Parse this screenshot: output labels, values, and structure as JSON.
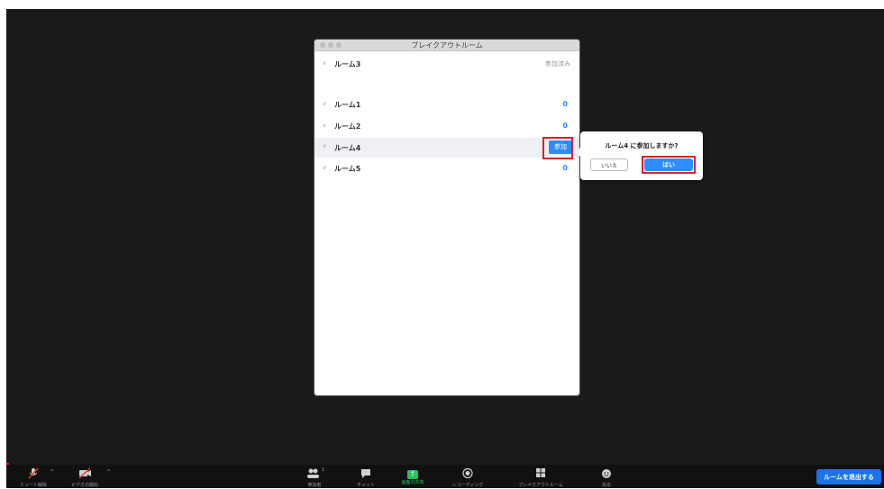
{
  "window": {
    "title": "ブレイクアウトルーム"
  },
  "rooms": [
    {
      "name": "ルーム3",
      "status": "参加済み"
    },
    {
      "name": "ルーム1",
      "count": "0"
    },
    {
      "name": "ルーム2",
      "count": "0"
    },
    {
      "name": "ルーム4",
      "join_label": "参加"
    },
    {
      "name": "ルーム5",
      "count": "0"
    }
  ],
  "confirm": {
    "question": "ルーム4 に参加しますか?",
    "no_label": "いいえ",
    "yes_label": "はい"
  },
  "toolbar": {
    "mute_label": "ミュート解除",
    "video_label": "ビデオの開始",
    "participants_label": "参加者",
    "participants_count": "1",
    "chat_label": "チャット",
    "share_label": "画面の共有",
    "record_label": "レコーディング",
    "breakout_label": "ブレイクアウトルーム",
    "reactions_label": "反応",
    "leave_label": "ルームを退出する"
  },
  "colors": {
    "accent": "#2d8cff",
    "highlight": "#e01e2b",
    "share_green": "#22c55e",
    "background": "#1a1a1a"
  }
}
